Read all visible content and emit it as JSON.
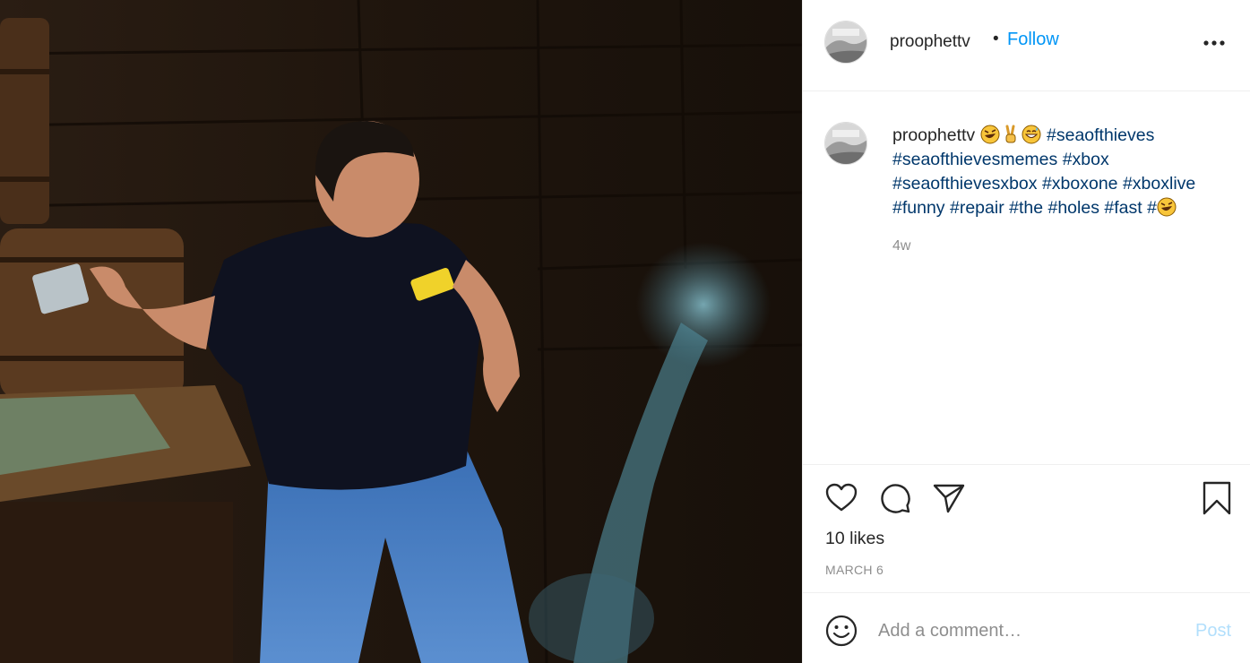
{
  "header": {
    "username": "proophettv",
    "separator": "•",
    "follow_label": "Follow"
  },
  "caption": {
    "username": "proophettv",
    "emojis_after_user": [
      "rolling-on-floor-laughing-emoji",
      "victory-hand-emoji",
      "grinning-sweat-emoji"
    ],
    "hashtags": [
      "#seaofthieves",
      "#seaofthievesmemes",
      "#xbox",
      "#seaofthievesxbox",
      "#xboxone",
      "#xboxlive",
      "#funny",
      "#repair",
      "#the",
      "#holes",
      "#fast",
      "#"
    ],
    "trailing_emoji": "rolling-on-floor-laughing-emoji",
    "time": "4w"
  },
  "actions": {
    "likes": "10 likes",
    "date": "MARCH 6",
    "icons": [
      "heart-icon",
      "comment-icon",
      "share-icon",
      "bookmark-icon"
    ]
  },
  "comment": {
    "placeholder": "Add a comment…",
    "post_label": "Post"
  },
  "colors": {
    "link_blue": "#0095f6",
    "hashtag": "#00376b",
    "muted": "#8e8e8e",
    "post_disabled": "#b2dffc"
  }
}
